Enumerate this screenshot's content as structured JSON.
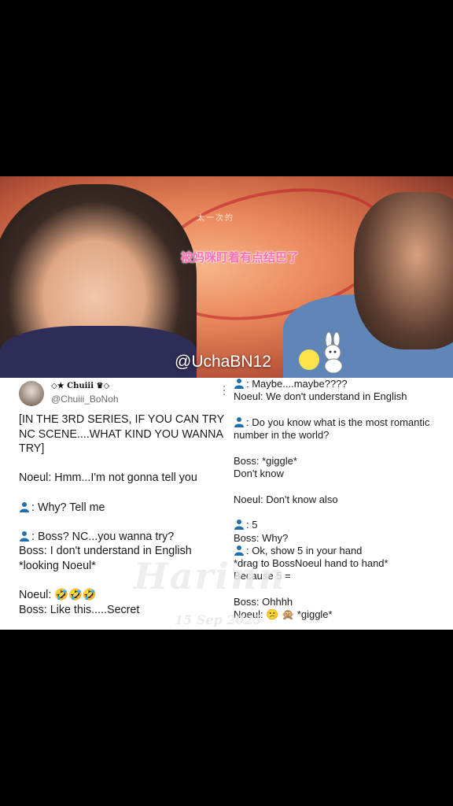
{
  "video": {
    "subtitle": "被妈咪盯着有点结巴了",
    "show_title": "太一次的",
    "handle": "@UchaBN12"
  },
  "tweet": {
    "display_name": "◇★ Chuiii ♛◇",
    "username": "@Chuiii_BoNoh",
    "left": [
      "[IN THE 3RD SERIES, IF YOU CAN TRY NC SCENE....WHAT KIND YOU WANNA TRY]",
      "",
      "Noeul: Hmm...I'm not gonna tell you",
      "",
      ": Why? Tell me",
      "",
      ": Boss? NC...you wanna try?",
      "Boss: I don't understand in English *looking Noeul*",
      "",
      "Noeul: 🤣🤣🤣",
      "Boss: Like this.....Secret"
    ],
    "right": [
      ": Maybe....maybe????",
      "Noeul: We don't understand in English",
      "",
      ": Do you know what is the most romantic number in the world?",
      "",
      "Boss: *giggle*",
      "Don't know",
      "",
      "Noeul: Don't know also",
      "",
      ": 5",
      "Boss: Why?",
      ": Ok, show 5 in your hand",
      "*drag to BossNoeul hand to hand*",
      "Because 5 =",
      "",
      "Boss: Ohhhh",
      "Noeul: 😕 🙊 *giggle*"
    ],
    "icon": "person-silhouette-icon"
  },
  "watermark": {
    "name": "Harinn",
    "date": "15 Sep 2025"
  },
  "colors": {
    "person_icon": "#1f6fa8",
    "subtitle_pink": "#ff6fb0"
  }
}
